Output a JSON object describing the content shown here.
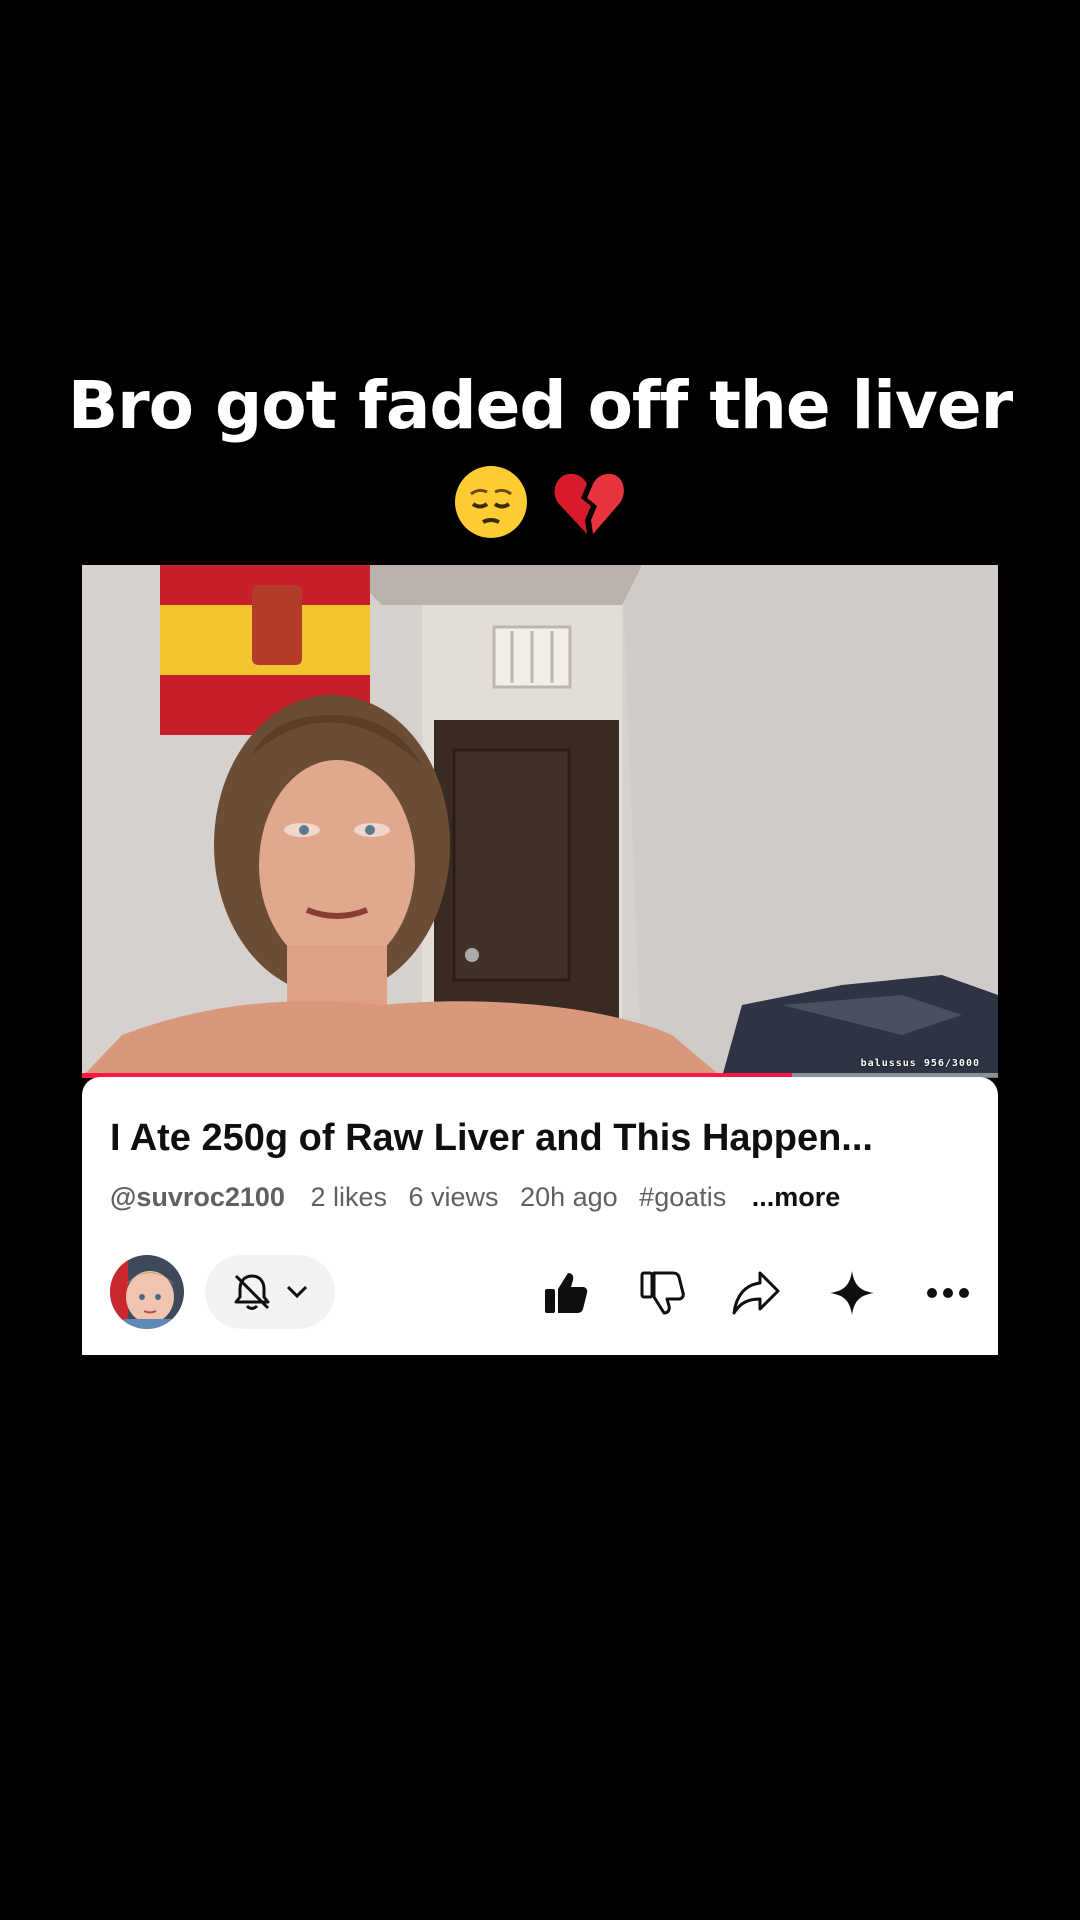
{
  "caption": {
    "text": "Bro got faded off the liver",
    "emojis": "😔💔"
  },
  "video": {
    "watermark": "balussus 956/3000",
    "progress": 0.775,
    "progress_color": "#ff1744"
  },
  "card": {
    "title": "I Ate 250g of Raw Liver and This Happen...",
    "handle": "@suvroc2100",
    "likes": "2 likes",
    "views": "6 views",
    "age": "20h ago",
    "hashtag": "#goatis",
    "more": "...more"
  },
  "actions": {
    "subscribe_icon": "bell-off-icon",
    "dropdown_icon": "chevron-down-icon",
    "like_icon": "thumbs-up-filled-icon",
    "dislike_icon": "thumbs-down-icon",
    "share_icon": "share-arrow-icon",
    "ai_icon": "sparkle-icon",
    "more_icon": "more-horizontal-icon"
  },
  "colors": {
    "background": "#000000",
    "card": "#ffffff",
    "text_primary": "#0f0f0f",
    "text_secondary": "#606060"
  }
}
